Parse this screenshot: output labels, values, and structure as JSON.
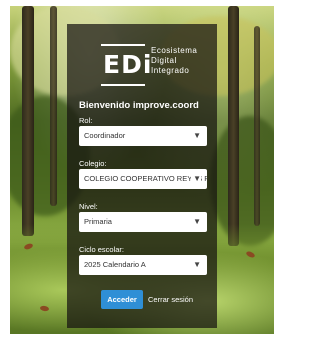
{
  "brand": {
    "logo_text": "EDi",
    "subtitle_lines": [
      "Ecosistema",
      "Digital",
      "Integrado"
    ]
  },
  "welcome_text": "Bienvenido improve.coord",
  "fields": [
    {
      "label": "Rol:",
      "value": "Coordinador",
      "arrow_icon": "caret-down"
    },
    {
      "label": "Colegio:",
      "value": "COLEGIO COOPERATIVO REYES PATRIA",
      "arrow_icon": "caret-down"
    },
    {
      "label": "Nivel:",
      "value": "Primaria",
      "arrow_icon": "caret-down"
    },
    {
      "label": "Ciclo escolar:",
      "value": "2025 Calendario A",
      "arrow_icon": "caret-down"
    }
  ],
  "actions": {
    "submit_label": "Acceder",
    "logout_label": "Cerrar sesión"
  },
  "colors": {
    "primary_button": "#2f8fd6",
    "panel": "rgba(22,20,16,0.72)"
  }
}
